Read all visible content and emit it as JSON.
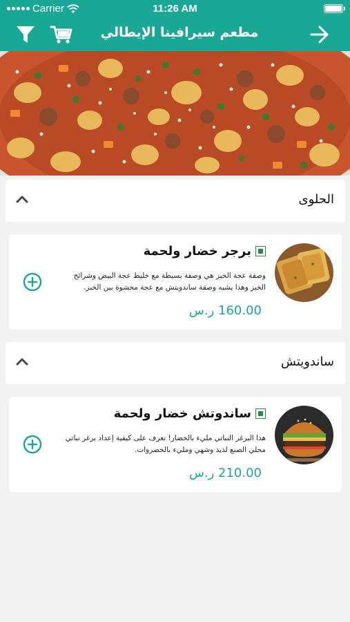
{
  "status_bar": {
    "carrier": "Carrier",
    "time": "11:26 AM"
  },
  "nav": {
    "title": "مطعم سيرافينا الإيطالي",
    "filter_icon": "filter-icon",
    "cart_icon": "cart-icon",
    "back_icon": "arrow-right-icon"
  },
  "hero": {
    "image": "minestrone-soup-photo"
  },
  "sections": [
    {
      "title": "الحلوى",
      "items": [
        {
          "name": "برجر خضار ولحمة",
          "description": "وصفة عجة الخبز هي وصفة بسيطة مع خليط عجة البيض وشرائح الخبز وهذا يشبه وصفة ساندويتش مع عجة محشوة بين الخبز.",
          "price": "160.00 ر.س",
          "image": "bread-omelette-photo"
        }
      ]
    },
    {
      "title": "ساندويتش",
      "items": [
        {
          "name": "ساندوتش خضار ولحمة",
          "description": "هذا البرغر النباتي مليء بالخضار! تعرف على كيفية إعداد برغر نباتي محلي الصنع لذيذ وشهي ومليء بالخضروات.",
          "price": "210.00 ر.س",
          "image": "burger-photo"
        }
      ]
    }
  ],
  "colors": {
    "primary": "#1aa896",
    "veg": "#2a8a4a",
    "background": "#f2f2f2"
  }
}
